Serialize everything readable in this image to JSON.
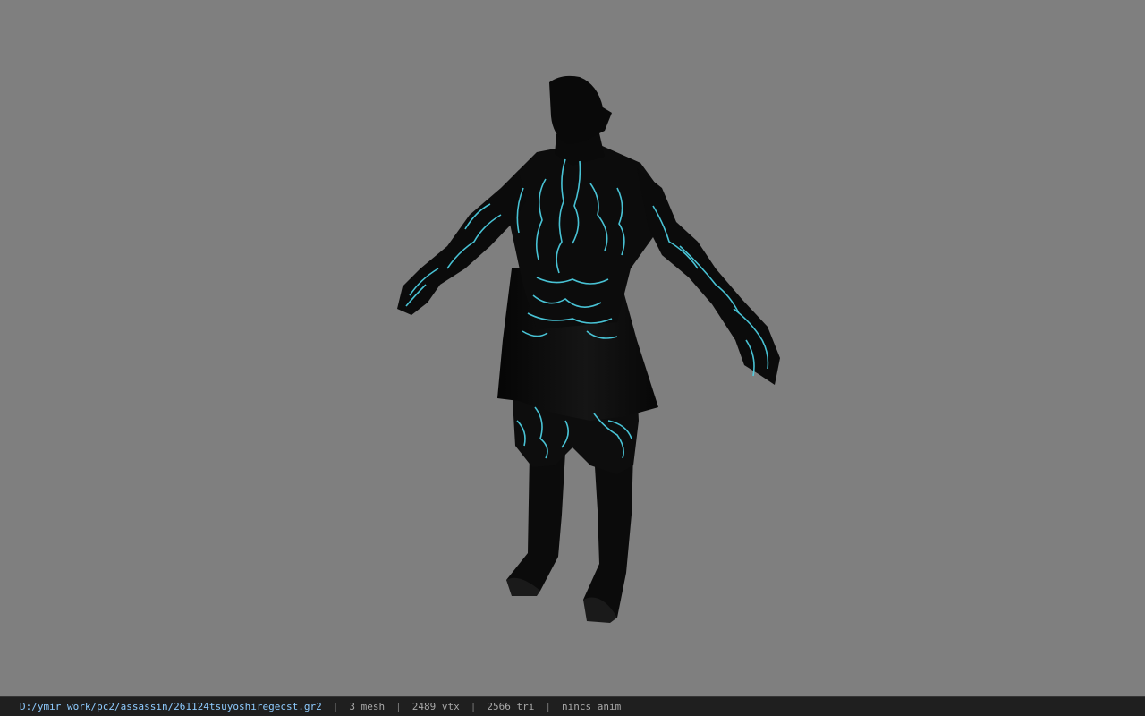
{
  "viewport": {
    "background": "#7f7f7f",
    "model_name": "3d-character-model",
    "glow_color": "#4fd6ea"
  },
  "statusbar": {
    "file_path": "D:/ymir work/pc2/assassin/261124tsuyoshiregecst.gr2",
    "mesh_count": "3 mesh",
    "vertex_count": "2489 vtx",
    "triangle_count": "2566 tri",
    "animation": "nincs anim",
    "separator": "|"
  }
}
